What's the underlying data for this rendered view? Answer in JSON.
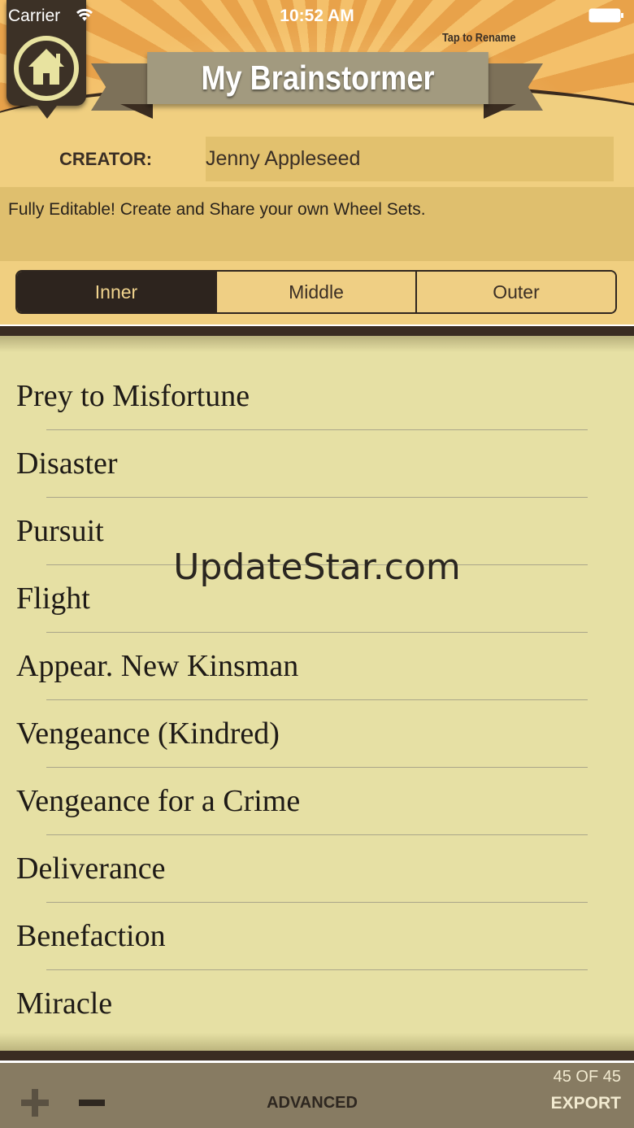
{
  "status_bar": {
    "carrier": "Carrier",
    "time": "10:52 AM"
  },
  "header": {
    "title": "My Brainstormer",
    "tap_hint": "Tap to Rename"
  },
  "creator": {
    "label": "CREATOR:",
    "value": "Jenny Appleseed"
  },
  "description": "Fully Editable! Create and Share your own Wheel Sets.",
  "segments": {
    "active": "Inner",
    "items": [
      "Inner",
      "Middle",
      "Outer"
    ]
  },
  "list_items": [
    "Prey to Misfortune",
    "Disaster",
    "Pursuit",
    "Flight",
    "Appear. New Kinsman",
    "Vengeance (Kindred)",
    "Vengeance for a Crime",
    "Deliverance",
    "Benefaction",
    "Miracle"
  ],
  "watermark": "UpdateStar.com",
  "toolbar": {
    "advanced": "ADVANCED",
    "count": "45 OF 45",
    "export": "EXPORT"
  },
  "colors": {
    "accent_dark": "#2d241e",
    "list_bg": "#e6e0a4",
    "header_orange": "#f4c06a"
  }
}
